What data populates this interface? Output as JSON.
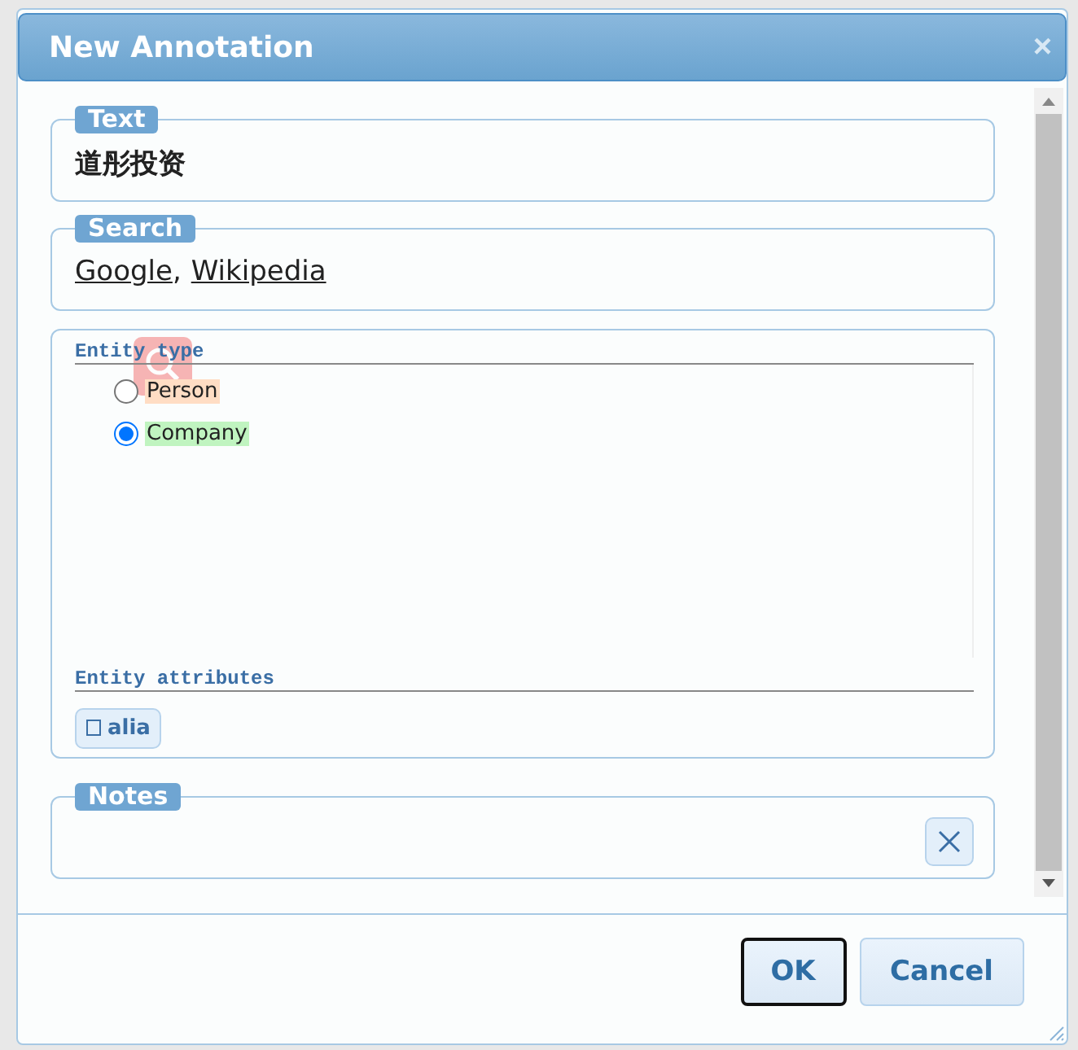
{
  "dialog": {
    "title": "New Annotation",
    "close": "×"
  },
  "text_field": {
    "legend": "Text",
    "value": "道彤投资"
  },
  "search": {
    "legend": "Search",
    "links": [
      "Google",
      "Wikipedia"
    ],
    "separator": ","
  },
  "entity_type": {
    "heading": "Entity type",
    "options": [
      {
        "label": "Person",
        "selected": false,
        "color": "#ffddc4"
      },
      {
        "label": "Company",
        "selected": true,
        "color": "#c0f4c0"
      }
    ]
  },
  "entity_attributes": {
    "heading": "Entity attributes",
    "items": [
      {
        "label": "alia",
        "checked": false
      }
    ]
  },
  "notes": {
    "legend": "Notes"
  },
  "buttons": [
    {
      "label": "OK",
      "kind": "default"
    },
    {
      "label": "Cancel",
      "kind": "normal"
    }
  ]
}
